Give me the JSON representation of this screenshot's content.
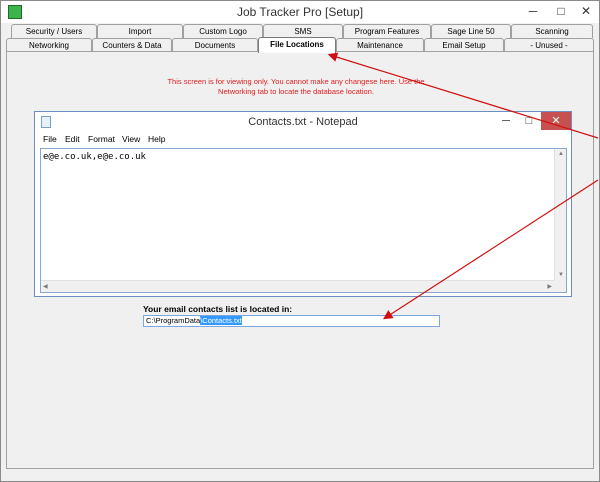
{
  "window": {
    "title": "Job Tracker Pro [Setup]",
    "minimize": "─",
    "maximize": "□",
    "close": "✕"
  },
  "tabs": {
    "row1": [
      "Security / Users",
      "Import",
      "Custom Logo",
      "SMS",
      "Program Features",
      "Sage Line 50",
      "Scanning"
    ],
    "row2": [
      "Networking",
      "Counters & Data",
      "Documents",
      "File Locations",
      "Maintenance",
      "Email Setup",
      "- Unused -"
    ],
    "active": "File Locations"
  },
  "notice": "This screen is for viewing only.  You cannot make any changese here.  Use the Networking tab to locate the database location.",
  "notepad": {
    "title": "Contacts.txt - Notepad",
    "menu": [
      "File",
      "Edit",
      "Format",
      "View",
      "Help"
    ],
    "content": "e@e.co.uk,e@e.co.uk",
    "minimize": "─",
    "maximize": "□",
    "close": "✕"
  },
  "location": {
    "label": "Your email contacts list is located in:",
    "path_prefix": "C:\\ProgramData",
    "path_selected": "\\Contacts.txt"
  },
  "colors": {
    "notice": "#e02020",
    "arrow": "#d01010",
    "selection": "#3399ff"
  }
}
